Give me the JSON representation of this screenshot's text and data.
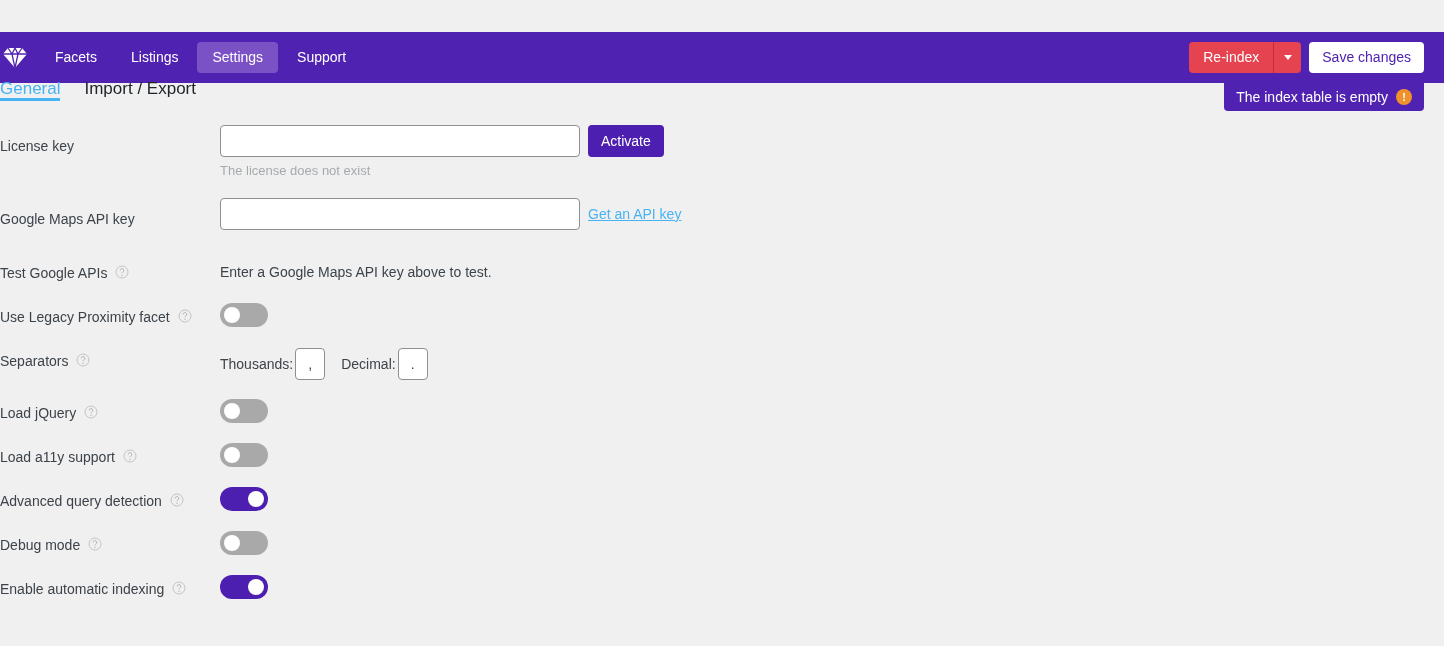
{
  "nav": {
    "items": [
      {
        "label": "Facets",
        "selected": false
      },
      {
        "label": "Listings",
        "selected": false
      },
      {
        "label": "Settings",
        "selected": true
      },
      {
        "label": "Support",
        "selected": false
      }
    ],
    "reindex": "Re-index",
    "save": "Save changes",
    "notice": "The index table is empty",
    "notice_icon": "!"
  },
  "tabs": [
    {
      "label": "General",
      "selected": true
    },
    {
      "label": "Import / Export",
      "selected": false
    }
  ],
  "settings": [
    {
      "kind": "license",
      "label": "License key",
      "help": false,
      "button": "Activate",
      "hint": "The license does not exist"
    },
    {
      "kind": "link",
      "label": "Google Maps API key",
      "help": false,
      "link": "Get an API key"
    },
    {
      "kind": "text",
      "label": "Test Google APIs",
      "help": true,
      "text": "Enter a Google Maps API key above to test."
    },
    {
      "kind": "toggle",
      "label": "Use Legacy Proximity facet",
      "help": true,
      "on": false
    },
    {
      "kind": "separators",
      "label": "Separators",
      "help": true,
      "thousands_label": "Thousands:",
      "thousands": ",",
      "decimal_label": "Decimal:",
      "decimal": "."
    },
    {
      "kind": "toggle",
      "label": "Load jQuery",
      "help": true,
      "on": false
    },
    {
      "kind": "toggle",
      "label": "Load a11y support",
      "help": true,
      "on": false
    },
    {
      "kind": "toggle",
      "label": "Advanced query detection",
      "help": true,
      "on": true
    },
    {
      "kind": "toggle",
      "label": "Debug mode",
      "help": true,
      "on": false
    },
    {
      "kind": "toggle",
      "label": "Enable automatic indexing",
      "help": true,
      "on": true
    }
  ]
}
